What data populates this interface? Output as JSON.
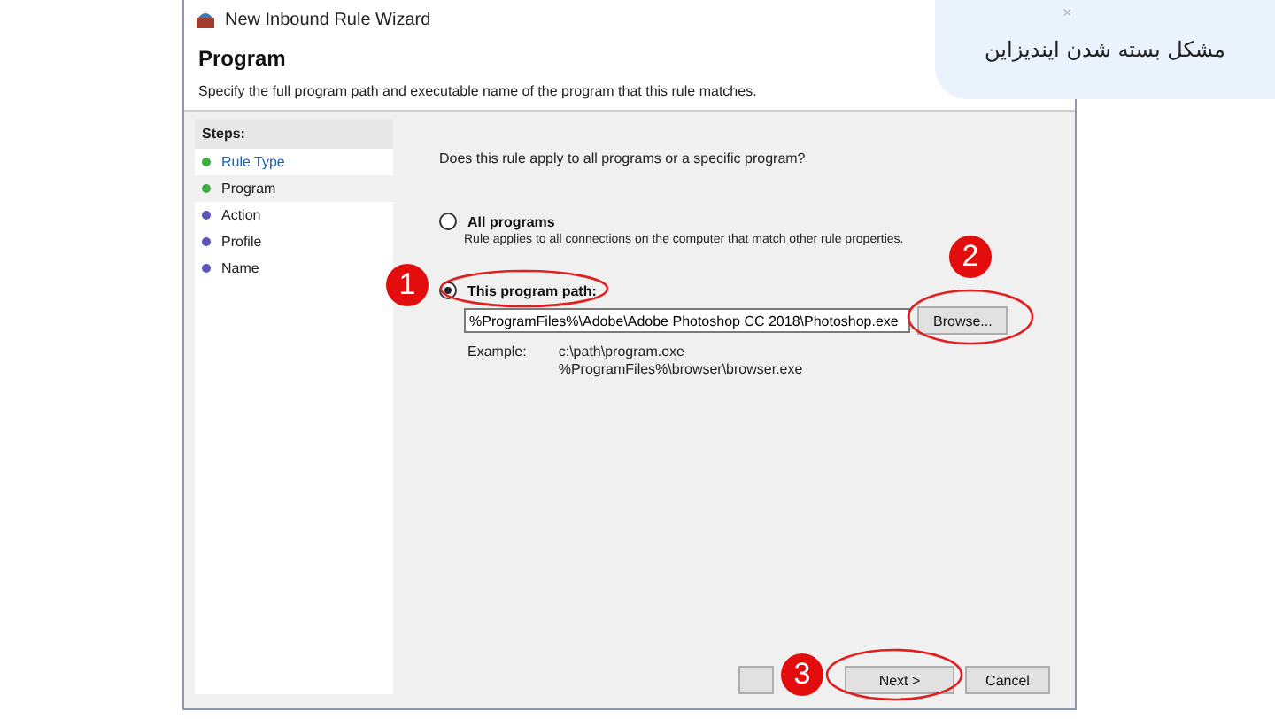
{
  "window": {
    "title": "New Inbound Rule Wizard"
  },
  "header": {
    "title": "Program",
    "description": "Specify the full program path and executable name of the program that this rule matches."
  },
  "steps": {
    "heading": "Steps:",
    "items": [
      {
        "label": "Rule Type",
        "selected": false,
        "done": true
      },
      {
        "label": "Program",
        "selected": true,
        "done": true
      },
      {
        "label": "Action",
        "selected": false,
        "done": false
      },
      {
        "label": "Profile",
        "selected": false,
        "done": false
      },
      {
        "label": "Name",
        "selected": false,
        "done": false
      }
    ]
  },
  "question": "Does this rule apply to all programs or a specific program?",
  "options": [
    {
      "label": "All programs",
      "description": "Rule applies to all connections on the computer that match other rule properties.",
      "selected": false
    },
    {
      "label": "This program path:",
      "selected": true
    }
  ],
  "path_field": {
    "value": "%ProgramFiles%\\Adobe\\Adobe Photoshop CC 2018\\Photoshop.exe"
  },
  "browse_button": "Browse...",
  "example": {
    "label": "Example:",
    "lines": [
      "c:\\path\\program.exe",
      "%ProgramFiles%\\browser\\browser.exe"
    ]
  },
  "buttons": [
    {
      "kind": "back"
    },
    {
      "label": "Next >",
      "kind": "next"
    },
    {
      "label": "Cancel",
      "kind": "cancel"
    }
  ],
  "annotations": [
    "1",
    "2",
    "3"
  ],
  "banner": {
    "text": "مشکل بسته شدن ایندیزاین",
    "close": "×"
  }
}
